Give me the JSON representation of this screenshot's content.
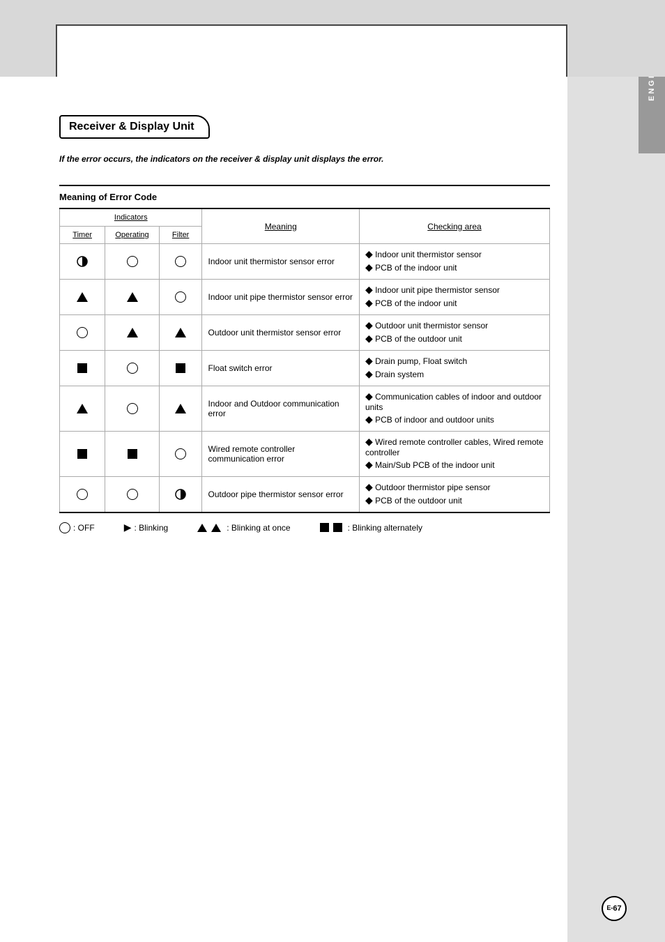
{
  "page": {
    "title": "Receiver & Display Unit",
    "subtitle": "If the error occurs, the indicators on the receiver & display unit displays the error.",
    "side_tab": "ENGLISH",
    "page_number": "E-67",
    "section_title": "Meaning of Error Code"
  },
  "table": {
    "headers": {
      "indicators": "Indicators",
      "timer": "Timer",
      "operating": "Operating",
      "filter": "Filter",
      "meaning": "Meaning",
      "checking_area": "Checking area"
    },
    "rows": [
      {
        "timer": "half-circle",
        "operating": "circle",
        "filter": "circle",
        "meaning": "Indoor unit thermistor sensor error",
        "checking": [
          "Indoor unit thermistor sensor",
          "PCB of the indoor unit"
        ]
      },
      {
        "timer": "triangle",
        "operating": "triangle",
        "filter": "circle",
        "meaning": "Indoor unit pipe thermistor sensor error",
        "checking": [
          "Indoor unit pipe thermistor sensor",
          "PCB of the indoor unit"
        ]
      },
      {
        "timer": "circle",
        "operating": "triangle",
        "filter": "triangle",
        "meaning": "Outdoor unit thermistor sensor error",
        "checking": [
          "Outdoor unit thermistor sensor",
          "PCB of the outdoor unit"
        ]
      },
      {
        "timer": "square",
        "operating": "circle",
        "filter": "square",
        "meaning": "Float switch error",
        "checking": [
          "Drain pump, Float switch",
          "Drain system"
        ]
      },
      {
        "timer": "triangle",
        "operating": "circle",
        "filter": "triangle",
        "meaning": "Indoor and Outdoor communication error",
        "checking": [
          "Communication cables of indoor and outdoor units",
          "PCB of indoor and outdoor units"
        ]
      },
      {
        "timer": "square",
        "operating": "square",
        "filter": "circle",
        "meaning": "Wired remote controller communication error",
        "checking": [
          "Wired remote controller cables, Wired remote controller",
          "Main/Sub PCB of the indoor unit"
        ]
      },
      {
        "timer": "circle",
        "operating": "circle",
        "filter": "half-circle",
        "meaning": "Outdoor pipe thermistor sensor error",
        "checking": [
          "Outdoor thermistor pipe sensor",
          "PCB of the outdoor unit"
        ]
      }
    ],
    "legend": {
      "off": "○ : OFF",
      "blinking": "▶ : Blinking",
      "blinking_at_once": "▲ ▲ : Blinking at once",
      "blinking_alternately": "■ ■ : Blinking alternately"
    }
  }
}
